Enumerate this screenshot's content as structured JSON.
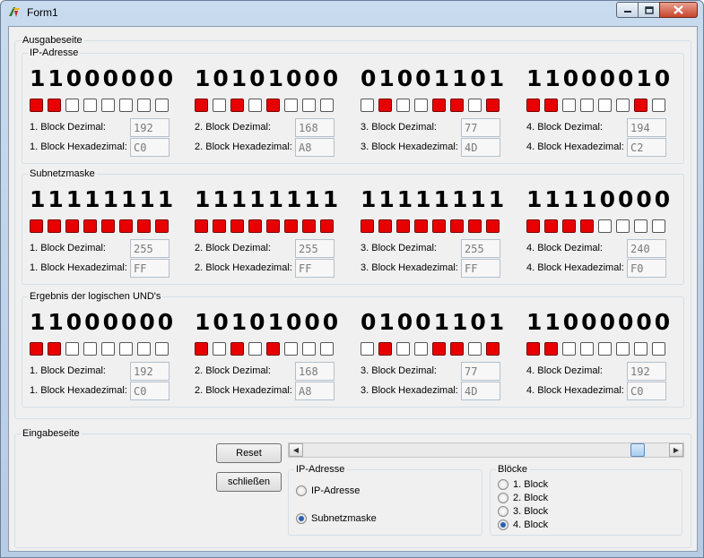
{
  "window": {
    "title": "Form1"
  },
  "ausgabe": {
    "label": "Ausgabeseite",
    "sections": [
      {
        "label": "IP-Adresse",
        "blocks": [
          {
            "bits": "11000000",
            "dez_label": "1. Block Dezimal:",
            "hex_label": "1. Block Hexadezimal:",
            "dez": "192",
            "hex": "C0"
          },
          {
            "bits": "10101000",
            "dez_label": "2. Block Dezimal:",
            "hex_label": "2. Block Hexadezimal:",
            "dez": "168",
            "hex": "A8"
          },
          {
            "bits": "01001101",
            "dez_label": "3. Block Dezimal:",
            "hex_label": "3. Block Hexadezimal:",
            "dez": "77",
            "hex": "4D"
          },
          {
            "bits": "11000010",
            "dez_label": "4. Block Dezimal:",
            "hex_label": "4. Block Hexadezimal:",
            "dez": "194",
            "hex": "C2"
          }
        ]
      },
      {
        "label": "Subnetzmaske",
        "blocks": [
          {
            "bits": "11111111",
            "dez_label": "1. Block Dezimal:",
            "hex_label": "1. Block Hexadezimal:",
            "dez": "255",
            "hex": "FF"
          },
          {
            "bits": "11111111",
            "dez_label": "2. Block Dezimal:",
            "hex_label": "2. Block Hexadezimal:",
            "dez": "255",
            "hex": "FF"
          },
          {
            "bits": "11111111",
            "dez_label": "3. Block Dezimal:",
            "hex_label": "3. Block Hexadezimal:",
            "dez": "255",
            "hex": "FF"
          },
          {
            "bits": "11110000",
            "dez_label": "4. Block Dezimal:",
            "hex_label": "4. Block Hexadezimal:",
            "dez": "240",
            "hex": "F0"
          }
        ]
      },
      {
        "label": "Ergebnis der logischen UND's",
        "blocks": [
          {
            "bits": "11000000",
            "dez_label": "1. Block Dezimal:",
            "hex_label": "1. Block Hexadezimal:",
            "dez": "192",
            "hex": "C0"
          },
          {
            "bits": "10101000",
            "dez_label": "2. Block Dezimal:",
            "hex_label": "2. Block Hexadezimal:",
            "dez": "168",
            "hex": "A8"
          },
          {
            "bits": "01001101",
            "dez_label": "3. Block Dezimal:",
            "hex_label": "3. Block Hexadezimal:",
            "dez": "77",
            "hex": "4D"
          },
          {
            "bits": "11000000",
            "dez_label": "4. Block Dezimal:",
            "hex_label": "4. Block Hexadezimal:",
            "dez": "192",
            "hex": "C0"
          }
        ]
      }
    ]
  },
  "eingabe": {
    "label": "Eingabeseite",
    "reset_label": "Reset",
    "close_label": "schließen",
    "scrollbar": {
      "value_fraction": 0.93
    },
    "ip_group": {
      "label": "IP-Adresse",
      "options": [
        "IP-Adresse",
        "Subnetzmaske"
      ],
      "selected": 1
    },
    "bloecke_group": {
      "label": "Blöcke",
      "options": [
        "1. Block",
        "2. Block",
        "3. Block",
        "4. Block"
      ],
      "selected": 3
    }
  },
  "colors": {
    "bit_on": "#e80000",
    "bit_off": "#ffffff"
  },
  "icons": {
    "app": "app-icon",
    "minimize": "minimize-icon",
    "maximize": "maximize-icon",
    "close": "close-icon"
  }
}
